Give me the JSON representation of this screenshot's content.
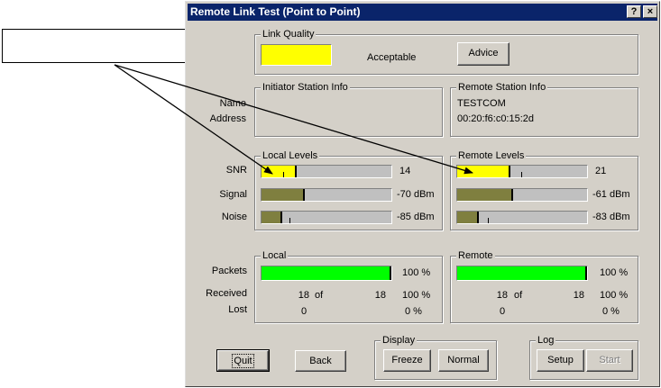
{
  "window": {
    "title": "Remote Link Test (Point to Point)",
    "help_button": "?",
    "close_button": "×"
  },
  "link_quality": {
    "group_title": "Link Quality",
    "status": "Acceptable",
    "indicator_color": "#ffff00",
    "advice_button": "Advice"
  },
  "initiator": {
    "group_title": "Initiator Station Info",
    "name_label": "Name",
    "address_label": "Address"
  },
  "remote_station": {
    "group_title": "Remote Station Info",
    "name": "TESTCOM",
    "address": "00:20:f6:c0:15:2d"
  },
  "level_labels": {
    "snr": "SNR",
    "signal": "Signal",
    "noise": "Noise"
  },
  "local_levels": {
    "group_title": "Local Levels",
    "snr": {
      "value": "14",
      "fill": 0.27,
      "marker": 0.18,
      "color": "#ffff00"
    },
    "signal": {
      "value": "-70 dBm",
      "fill": 0.33,
      "color": "#7f7f3f"
    },
    "noise": {
      "value": "-85 dBm",
      "fill": 0.16,
      "marker": 0.23,
      "color": "#7f7f3f"
    }
  },
  "remote_levels": {
    "group_title": "Remote Levels",
    "snr": {
      "value": "21",
      "fill": 0.41,
      "marker": 0.51,
      "color": "#ffff00"
    },
    "signal": {
      "value": "-61 dBm",
      "fill": 0.43,
      "color": "#7f7f3f"
    },
    "noise": {
      "value": "-83 dBm",
      "fill": 0.17,
      "marker": 0.25,
      "color": "#7f7f3f"
    }
  },
  "stats_labels": {
    "packets": "Packets",
    "received": "Received",
    "lost": "Lost",
    "of": "of"
  },
  "local_stats": {
    "group_title": "Local",
    "packets_percent": "100 %",
    "packets_fill": 1.0,
    "received": "18",
    "total": "18",
    "received_percent": "100 %",
    "lost": "0",
    "lost_percent": "0 %",
    "bar_color": "#00ff00"
  },
  "remote_stats": {
    "group_title": "Remote",
    "packets_percent": "100 %",
    "packets_fill": 1.0,
    "received": "18",
    "total": "18",
    "received_percent": "100 %",
    "lost": "0",
    "lost_percent": "0 %",
    "bar_color": "#00ff00"
  },
  "buttons": {
    "quit": "Quit",
    "back": "Back"
  },
  "display": {
    "group_title": "Display",
    "freeze": "Freeze",
    "normal": "Normal"
  },
  "log": {
    "group_title": "Log",
    "setup": "Setup",
    "start": "Start"
  }
}
